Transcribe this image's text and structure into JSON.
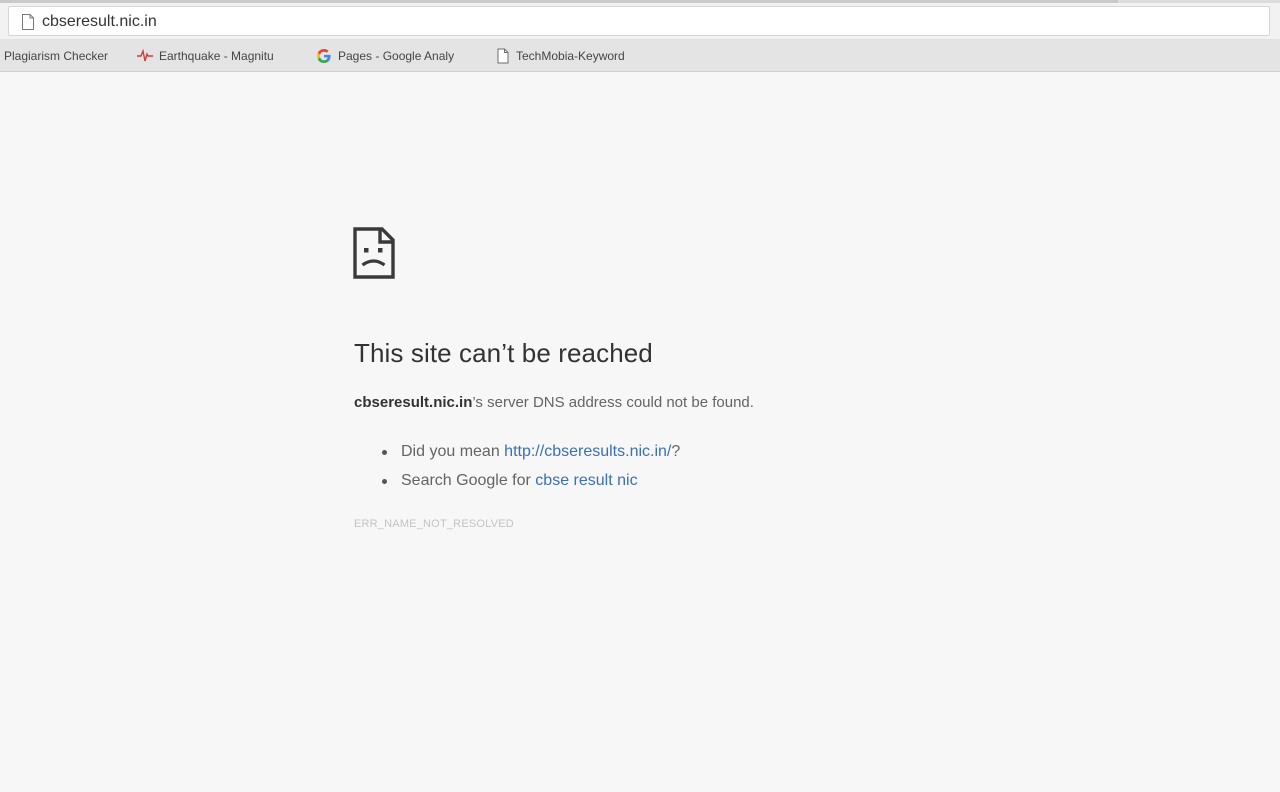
{
  "browser": {
    "address_bar": {
      "url": "cbseresult.nic.in",
      "page_icon": "page-icon"
    },
    "bookmarks": [
      {
        "label": "Plagiarism Checker",
        "icon": ""
      },
      {
        "label": "Earthquake - Magnitu",
        "icon": "seismograph-icon"
      },
      {
        "label": "Pages - Google Analy",
        "icon": "google-icon"
      },
      {
        "label": "TechMobia-Keyword",
        "icon": "page-icon"
      }
    ]
  },
  "error_page": {
    "icon": "sad-page-icon",
    "title": "This site can’t be reached",
    "host": "cbseresult.nic.in",
    "message_suffix": "’s server DNS address could not be found.",
    "suggestions": {
      "did_you_mean_prefix": "Did you mean ",
      "did_you_mean_link": "http://cbseresults.nic.in/",
      "did_you_mean_suffix": "?",
      "search_prefix": "Search Google for ",
      "search_link": "cbse result nic"
    },
    "error_code": "ERR_NAME_NOT_RESOLVED"
  },
  "colors": {
    "link": "#3b6fb6",
    "page_background": "#f7f7f7",
    "bookmarks_bar": "#e4e4e4"
  }
}
